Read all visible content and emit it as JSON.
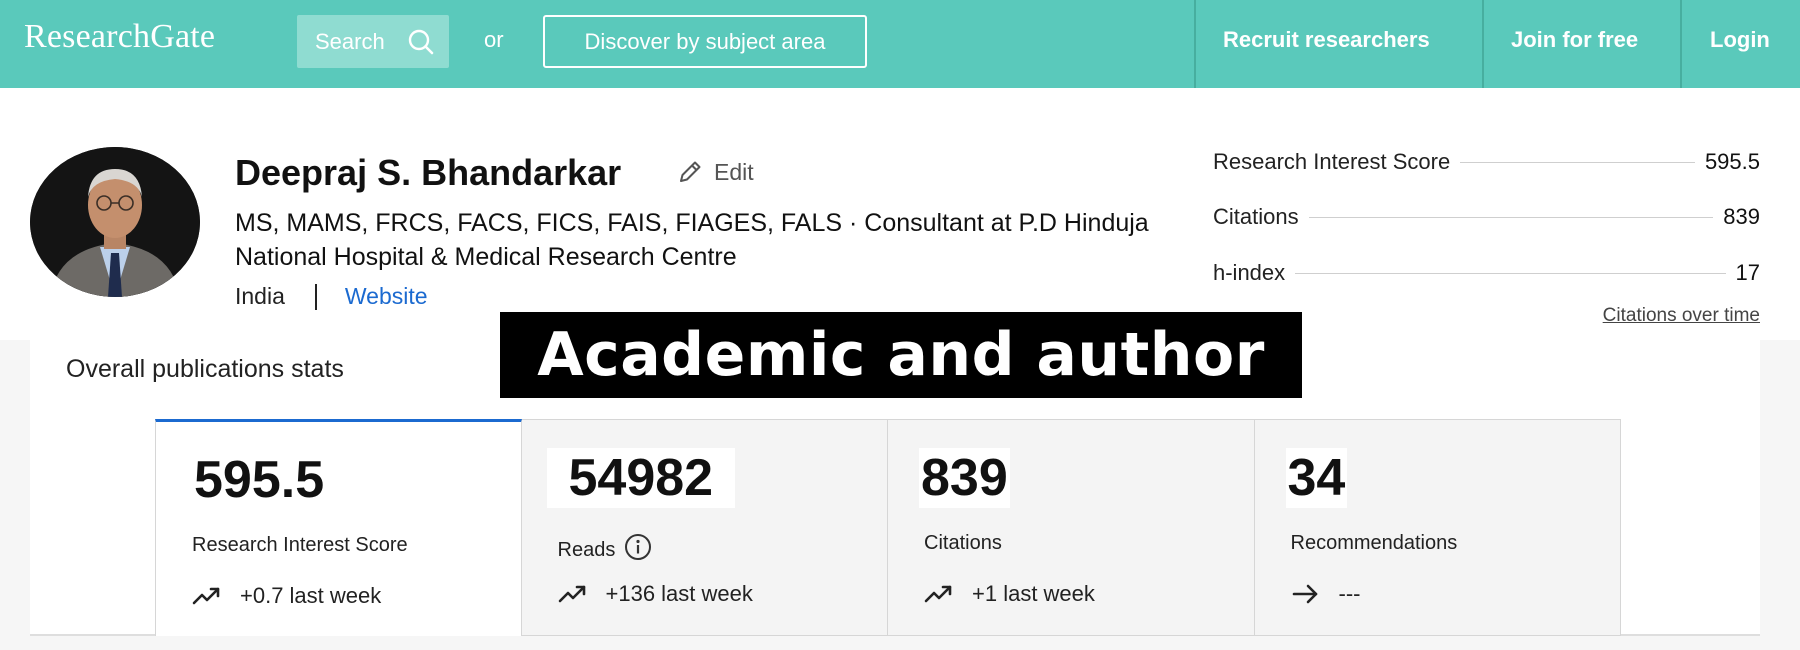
{
  "header": {
    "logo": "ResearchGate",
    "search_label": "Search",
    "or_text": "or",
    "discover_label": "Discover by subject area",
    "nav": [
      "Recruit researchers",
      "Join for free",
      "Login"
    ]
  },
  "profile": {
    "name": "Deepraj S. Bhandarkar",
    "edit_label": "Edit",
    "degrees": "MS, MAMS, FRCS, FACS, FICS, FAIS, FIAGES, FALS · Consultant at P.D Hinduja National Hospital & Medical Research Centre",
    "country": "India",
    "website_label": "Website"
  },
  "stats": [
    {
      "label": "Research Interest Score",
      "value": "595.5"
    },
    {
      "label": "Citations",
      "value": "839"
    },
    {
      "label": "h-index",
      "value": "17"
    }
  ],
  "citations_over_time": "Citations over time",
  "publications": {
    "title": "Overall publications stats",
    "cards": [
      {
        "value": "595.5",
        "label": "Research Interest Score",
        "trend": "+0.7 last week",
        "trend_icon": "trending-up-icon"
      },
      {
        "value": "54982",
        "label": "Reads",
        "trend": "+136 last week",
        "trend_icon": "trending-up-icon"
      },
      {
        "value": "839",
        "label": "Citations",
        "trend": "+1 last week",
        "trend_icon": "trending-up-icon"
      },
      {
        "value": "34",
        "label": "Recommendations",
        "trend": "---",
        "trend_icon": "arrow-right-icon"
      }
    ]
  },
  "caption": "Academic and author",
  "colors": {
    "brand_teal": "#5ac9bb",
    "link_blue": "#1b6ad0",
    "caption_bg": "#000000"
  }
}
